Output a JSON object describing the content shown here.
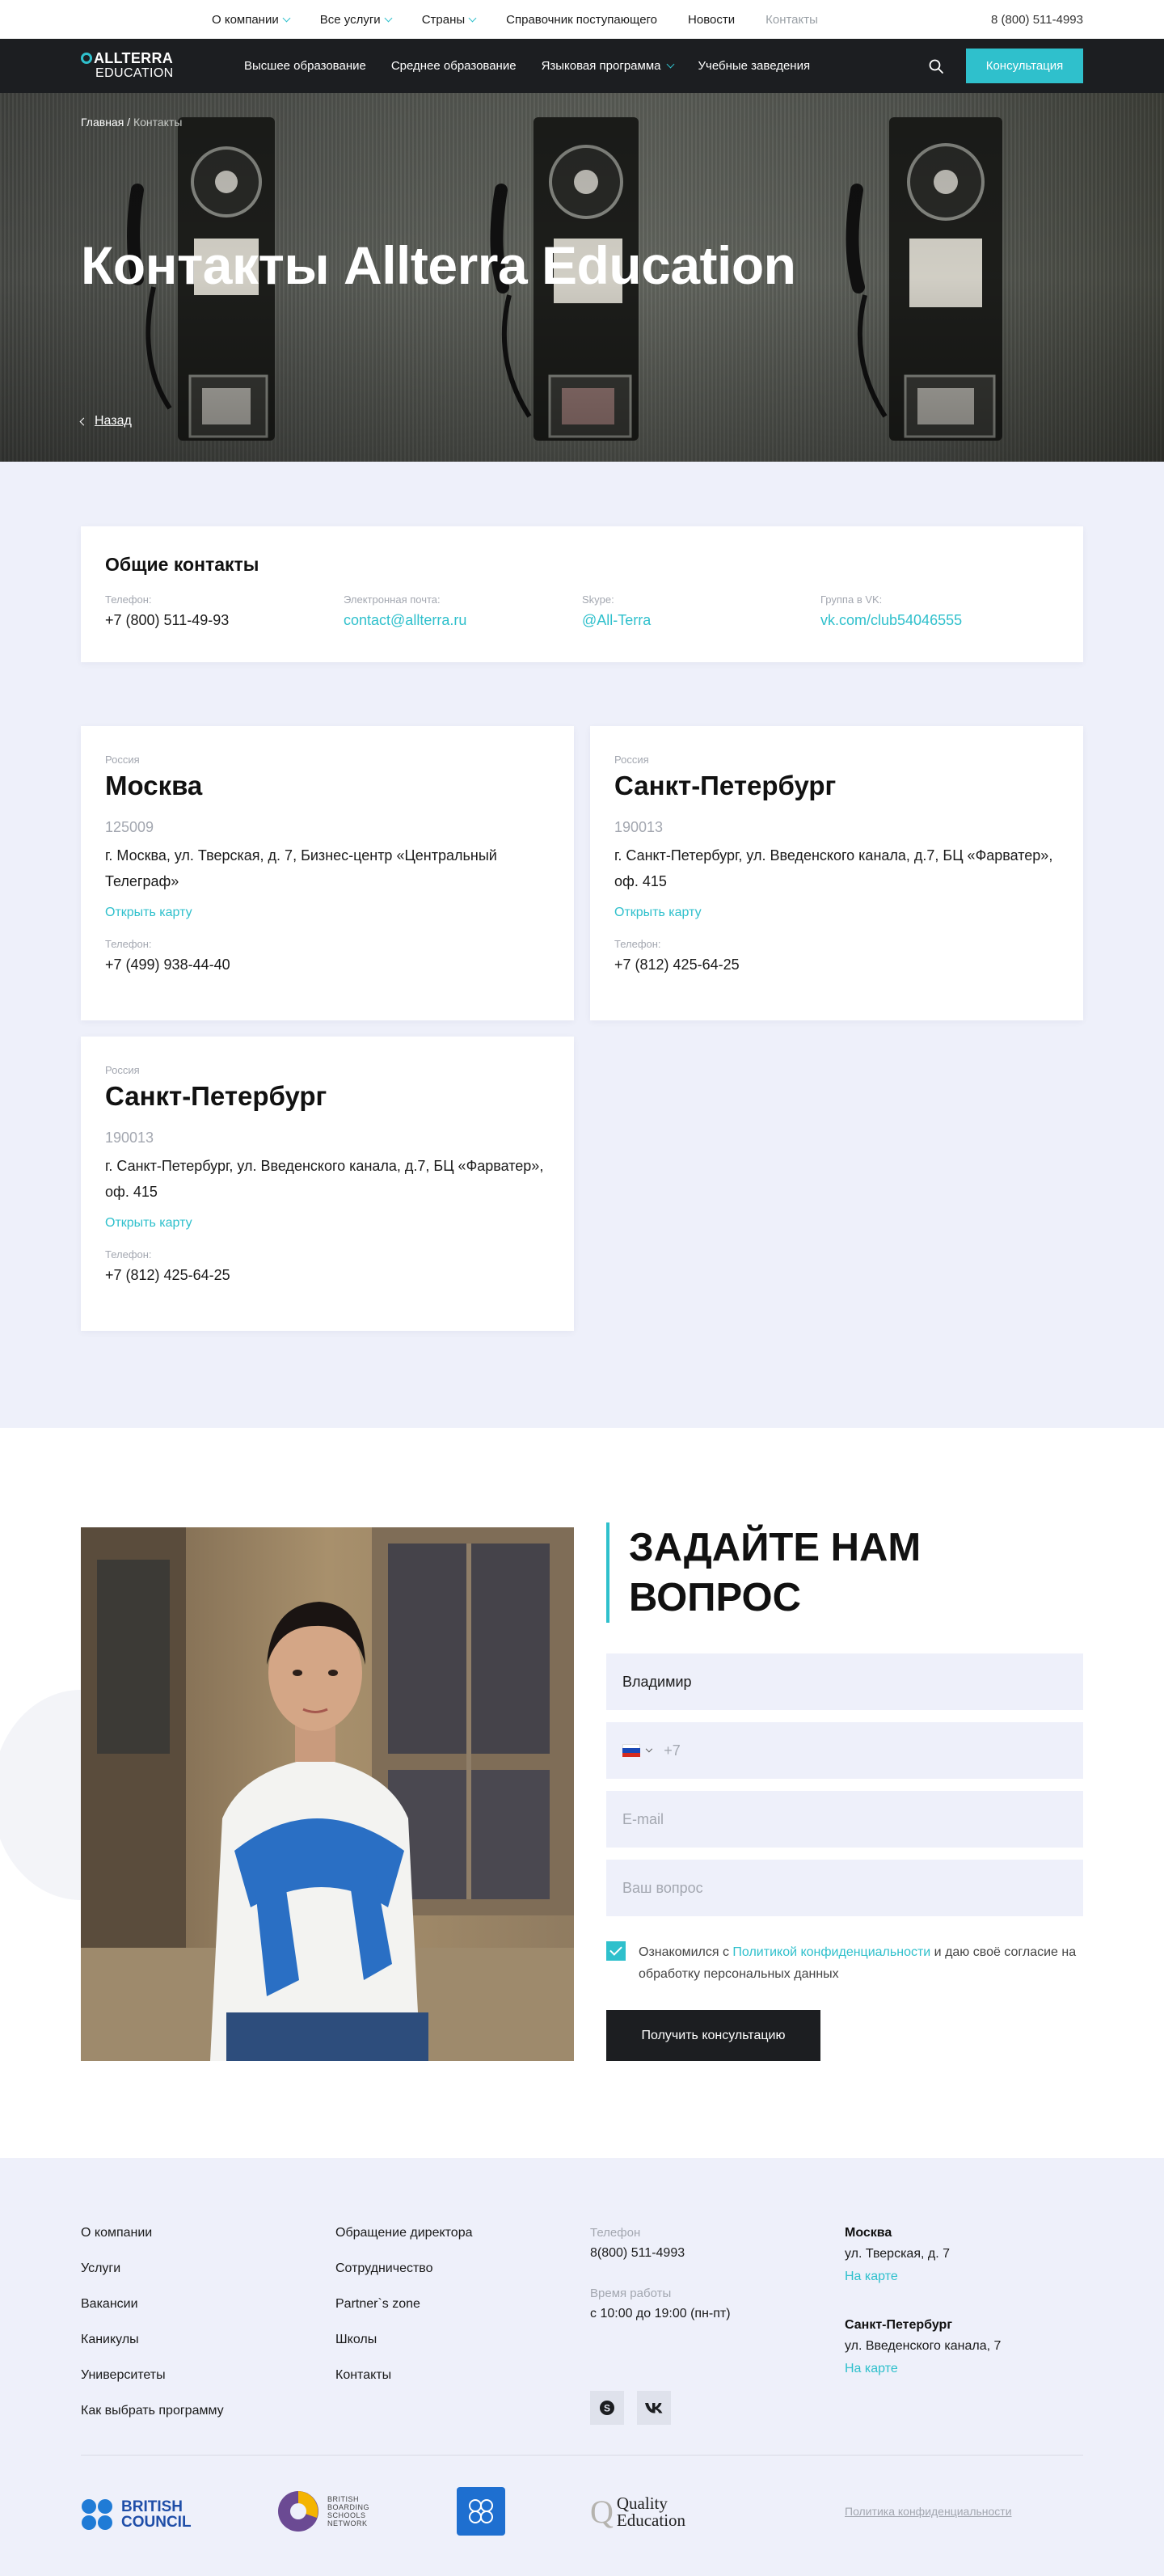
{
  "topbar": {
    "menu": [
      {
        "label": "О компании",
        "dropdown": true
      },
      {
        "label": "Все услуги",
        "dropdown": true
      },
      {
        "label": "Страны",
        "dropdown": true
      },
      {
        "label": "Справочник поступающего",
        "dropdown": false
      },
      {
        "label": "Новости",
        "dropdown": false
      },
      {
        "label": "Контакты",
        "dropdown": false,
        "active": true
      }
    ],
    "phone": "8 (800) 511-4993"
  },
  "navbar": {
    "logo_line1": "ALLTERRA",
    "logo_line2": "EDUCATION",
    "menu": [
      {
        "label": "Высшее образование"
      },
      {
        "label": "Среднее образование"
      },
      {
        "label": "Языковая программа",
        "dropdown": true
      },
      {
        "label": "Учебные заведения"
      }
    ],
    "cta": "Консультация"
  },
  "hero": {
    "breadcrumb_home": "Главная",
    "breadcrumb_sep": " / ",
    "breadcrumb_current": "Контакты",
    "title": "Контакты Allterra Education",
    "back": "Назад"
  },
  "general": {
    "title": "Общие контакты",
    "items": [
      {
        "label": "Телефон:",
        "value": "+7 (800) 511-49-93",
        "link": false
      },
      {
        "label": "Электронная почта:",
        "value": "contact@allterra.ru",
        "link": true
      },
      {
        "label": "Skype:",
        "value": "@All-Terra",
        "link": true
      },
      {
        "label": "Группа в VK:",
        "value": "vk.com/club54046555",
        "link": true
      }
    ]
  },
  "offices": [
    {
      "country": "Россия",
      "city": "Москва",
      "zip": "125009",
      "address": "г. Москва, ул. Тверская, д. 7, Бизнес-центр «Центральный Телеграф»",
      "map": "Открыть карту",
      "phone_label": "Телефон:",
      "phone": "+7 (499) 938-44-40"
    },
    {
      "country": "Россия",
      "city": "Санкт-Петербург",
      "zip": "190013",
      "address": "г. Санкт-Петербург, ул. Введенского канала, д.7, БЦ «Фарватер», оф. 415",
      "map": "Открыть карту",
      "phone_label": "Телефон:",
      "phone": "+7 (812) 425-64-25"
    },
    {
      "country": "Россия",
      "city": "Санкт-Петербург",
      "zip": "190013",
      "address": "г. Санкт-Петербург, ул. Введенского канала, д.7, БЦ «Фарватер», оф. 415",
      "map": "Открыть карту",
      "phone_label": "Телефон:",
      "phone": "+7 (812) 425-64-25"
    }
  ],
  "form": {
    "title": "ЗАДАЙТЕ НАМ ВОПРОС",
    "name_value": "Владимир",
    "phone_placeholder": "+7",
    "email_placeholder": "E-mail",
    "question_placeholder": "Ваш вопрос",
    "consent_pre": "Ознакомился с ",
    "consent_link": "Политикой конфиденциальности",
    "consent_post": " и даю своё согласие на обработку персональных данных",
    "consent_checked": true,
    "submit": "Получить консультацию"
  },
  "footer": {
    "col1": [
      "О компании",
      "Услуги",
      "Вакансии",
      "Каникулы",
      "Университеты",
      "Как выбрать программу"
    ],
    "col2": [
      "Обращение директора",
      "Сотрудничество",
      "Partner`s zone",
      "Школы",
      "Контакты"
    ],
    "phone_label": "Телефон",
    "phone": "8(800) 511-4993",
    "hours_label": "Время работы",
    "hours": "с 10:00 до 19:00 (пн-пт)",
    "offices": [
      {
        "city": "Москва",
        "street": "ул. Тверская, д. 7",
        "map": "На карте"
      },
      {
        "city": "Санкт-Петербург",
        "street": "ул. Введенского канала, 7",
        "map": "На карте"
      }
    ],
    "partners": {
      "british_council_1": "BRITISH",
      "british_council_2": "COUNCIL",
      "bbsn_1": "BRITISH",
      "bbsn_2": "BOARDING",
      "bbsn_3": "SCHOOLS",
      "bbsn_4": "NETWORK",
      "quality_1": "Quality",
      "quality_2": "Education"
    },
    "privacy": "Политика конфиденциальности"
  },
  "colors": {
    "accent": "#2fc0cc",
    "dark": "#1c1e21",
    "light_bg": "#eef0fa"
  }
}
